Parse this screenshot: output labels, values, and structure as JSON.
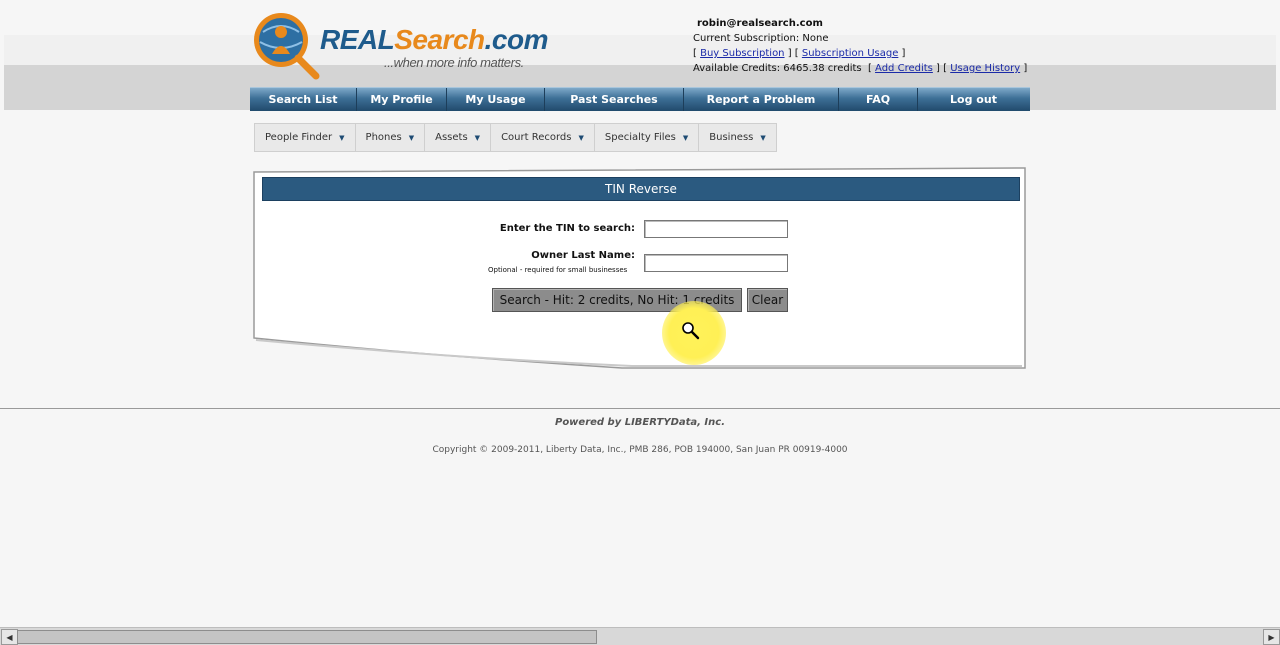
{
  "logo": {
    "brand_real": "REAL",
    "brand_search": "Search",
    "brand_com": ".com",
    "tagline": "...when more info matters."
  },
  "account": {
    "email": "robin@realsearch.com",
    "subscription": "Current Subscription: None",
    "buy_subscription": "Buy Subscription",
    "subscription_usage": "Subscription Usage",
    "credits": "Available Credits: 6465.38 credits",
    "add_credits": "Add Credits",
    "usage_history": "Usage History"
  },
  "main_nav": [
    {
      "label": "Search List"
    },
    {
      "label": "My Profile"
    },
    {
      "label": "My Usage"
    },
    {
      "label": "Past Searches"
    },
    {
      "label": "Report a Problem"
    },
    {
      "label": "FAQ"
    },
    {
      "label": "Log out"
    }
  ],
  "sub_nav": [
    {
      "label": "People Finder"
    },
    {
      "label": "Phones"
    },
    {
      "label": "Assets"
    },
    {
      "label": "Court Records"
    },
    {
      "label": "Specialty Files"
    },
    {
      "label": "Business"
    }
  ],
  "form": {
    "title": "TIN Reverse",
    "tin_label": "Enter the TIN to search:",
    "tin_value": "",
    "owner_label": "Owner Last Name:",
    "owner_hint": "Optional - required for small businesses",
    "owner_value": "",
    "search_button": "Search - Hit: 2 credits, No Hit: 1 credits",
    "clear_button": "Clear"
  },
  "footer": {
    "powered": "Powered by LIBERTYData, Inc.",
    "copyright": "Copyright © 2009-2011, Liberty Data, Inc., PMB 286, POB 194000, San Juan PR 00919-4000"
  },
  "colors": {
    "nav_blue": "#2b5a80",
    "brand_orange": "#e8891c",
    "link": "#1a2aa8"
  }
}
